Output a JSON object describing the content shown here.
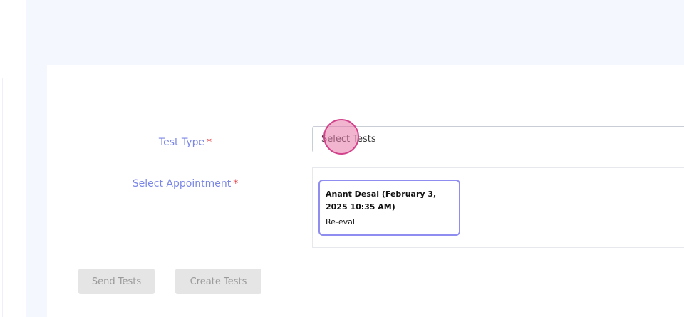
{
  "form": {
    "test_type": {
      "label": "Test Type",
      "required_mark": "*",
      "placeholder": "Select Tests"
    },
    "appointment": {
      "label": "Select Appointment",
      "required_mark": "*",
      "options": [
        {
          "name": "Anant Desai (February 3, 2025 10:35 AM)",
          "type": "Re-eval",
          "selected": true
        }
      ]
    },
    "buttons": {
      "send_label": "Send Tests",
      "create_label": "Create Tests"
    }
  },
  "colors": {
    "label": "#7b87e6",
    "required": "#e5484d",
    "selected_border": "#8f8df0",
    "page_background": "#f5f7fe",
    "disabled_button": "#e5e5e5"
  }
}
